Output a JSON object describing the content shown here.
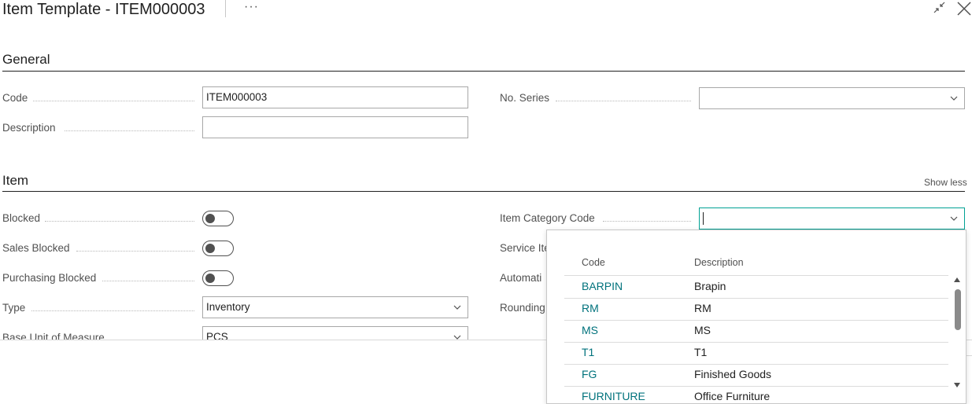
{
  "header": {
    "title": "Item Template - ITEM000003",
    "more_label": "···",
    "collapse_icon": "collapse-icon",
    "close_icon": "close-icon"
  },
  "general": {
    "title": "General",
    "code_label": "Code",
    "code_value": "ITEM000003",
    "description_label": "Description",
    "description_value": "",
    "no_series_label": "No. Series",
    "no_series_value": ""
  },
  "item": {
    "title": "Item",
    "show_less": "Show less",
    "blocked_label": "Blocked",
    "sales_blocked_label": "Sales Blocked",
    "purchasing_blocked_label": "Purchasing Blocked",
    "type_label": "Type",
    "type_value": "Inventory",
    "base_uom_label": "Base Unit of Measure",
    "base_uom_value": "PCS",
    "item_category_label": "Item Category Code",
    "item_category_value": "",
    "service_label": "Service Ite",
    "automatic_label": "Automati",
    "rounding_label": "Rounding"
  },
  "toggles": {
    "blocked": false,
    "sales_blocked": false,
    "purchasing_blocked": false
  },
  "lookup": {
    "col_code": "Code",
    "col_description": "Description",
    "rows": [
      {
        "code": "BARPIN",
        "description": "Brapin"
      },
      {
        "code": "RM",
        "description": "RM"
      },
      {
        "code": "MS",
        "description": "MS"
      },
      {
        "code": "T1",
        "description": "T1"
      },
      {
        "code": "FG",
        "description": "Finished Goods"
      },
      {
        "code": "FURNITURE",
        "description": "Office Furniture"
      }
    ]
  },
  "colors": {
    "accent": "#00a294",
    "link": "#00727c",
    "text": "#212121",
    "label": "#505050"
  }
}
